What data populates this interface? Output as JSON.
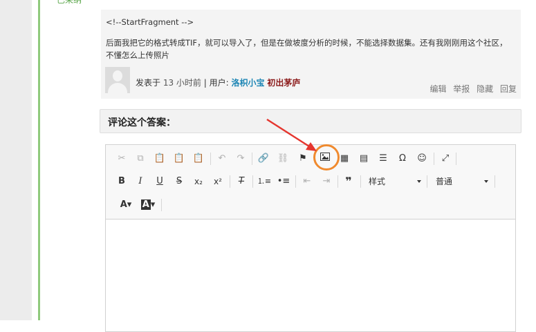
{
  "topcut": "已采纳",
  "reply": {
    "fragment": "<!--StartFragment -->",
    "message": "后面我把它的格式转成TIF，就可以导入了，但是在做坡度分析的时候，不能选择数据集。还有我刚刚用这个社区，不懂怎么上传照片",
    "posted_prefix": "发表于",
    "time": "13 小时前",
    "user_prefix": "| 用户:",
    "username": "洛枳小宝",
    "rank": "初出茅庐",
    "actions": [
      "编辑",
      "举报",
      "隐藏",
      "回复"
    ]
  },
  "comment_bar": "评论这个答案：",
  "toolbar": {
    "style_combo": "样式",
    "format_combo": "普通"
  },
  "colors": {
    "accent": "#1e86b5",
    "highlight": "#f08a2e",
    "arrow": "#e5362f",
    "green": "#8fc97c"
  }
}
